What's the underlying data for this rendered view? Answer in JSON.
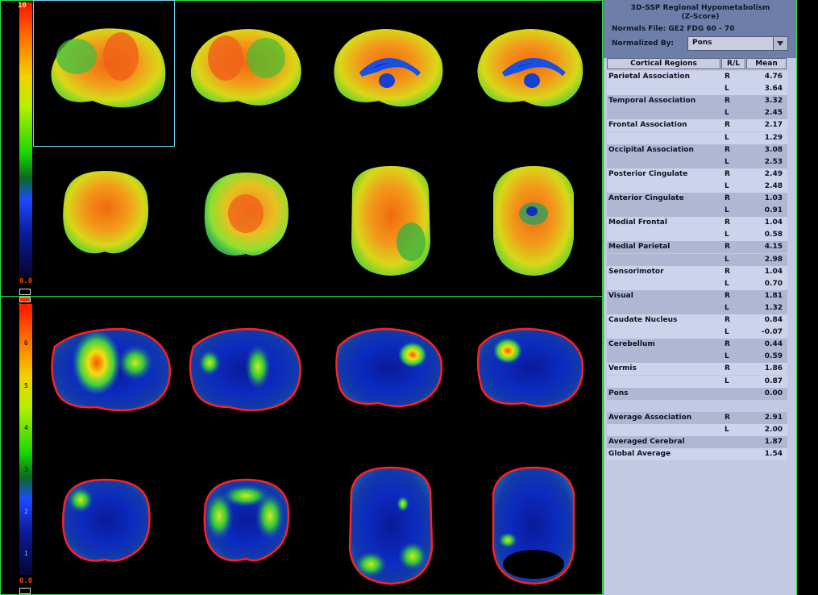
{
  "colorbar_top": {
    "max_label": "10",
    "min_label": "0.0"
  },
  "colorbar_bottom": {
    "max_label": "7.0",
    "min_label": "0.0",
    "ticks": [
      "6",
      "5",
      "4",
      "3",
      "2",
      "1"
    ]
  },
  "panel": {
    "title_line1": "3D-SSP Regional Hypometabolism",
    "title_line2": "(Z-Score)",
    "normals_file": "Normals File: GE2 FDG 60 - 70",
    "normalized_label": "Normalized By:",
    "normalized_value": "Pons",
    "headers": {
      "region": "Cortical Regions",
      "side": "R/L",
      "mean": "Mean"
    },
    "rows": [
      {
        "name": "Parietal Association",
        "side": "R",
        "mean": "4.76"
      },
      {
        "name": "",
        "side": "L",
        "mean": "3.64"
      },
      {
        "name": "Temporal Association",
        "side": "R",
        "mean": "3.32"
      },
      {
        "name": "",
        "side": "L",
        "mean": "2.45"
      },
      {
        "name": "Frontal Association",
        "side": "R",
        "mean": "2.17"
      },
      {
        "name": "",
        "side": "L",
        "mean": "1.29"
      },
      {
        "name": "Occipital Association",
        "side": "R",
        "mean": "3.08"
      },
      {
        "name": "",
        "side": "L",
        "mean": "2.53"
      },
      {
        "name": "Posterior Cingulate",
        "side": "R",
        "mean": "2.49"
      },
      {
        "name": "",
        "side": "L",
        "mean": "2.48"
      },
      {
        "name": "Anterior Cingulate",
        "side": "R",
        "mean": "1.03"
      },
      {
        "name": "",
        "side": "L",
        "mean": "0.91"
      },
      {
        "name": "Medial Frontal",
        "side": "R",
        "mean": "1.04"
      },
      {
        "name": "",
        "side": "L",
        "mean": "0.58"
      },
      {
        "name": "Medial Parietal",
        "side": "R",
        "mean": "4.15"
      },
      {
        "name": "",
        "side": "L",
        "mean": "2.98"
      },
      {
        "name": "Sensorimotor",
        "side": "R",
        "mean": "1.04"
      },
      {
        "name": "",
        "side": "L",
        "mean": "0.70"
      },
      {
        "name": "Visual",
        "side": "R",
        "mean": "1.81"
      },
      {
        "name": "",
        "side": "L",
        "mean": "1.32"
      },
      {
        "name": "Caudate Nucleus",
        "side": "R",
        "mean": "0.84"
      },
      {
        "name": "",
        "side": "L",
        "mean": "-0.07"
      },
      {
        "name": "Cerebellum",
        "side": "R",
        "mean": "0.44"
      },
      {
        "name": "",
        "side": "L",
        "mean": "0.59"
      },
      {
        "name": "Vermis",
        "side": "R",
        "mean": "1.86"
      },
      {
        "name": "",
        "side": "L",
        "mean": "0.87"
      },
      {
        "name": "Pons",
        "side": "",
        "mean": "0.00"
      },
      {
        "name": "",
        "side": "",
        "mean": ""
      },
      {
        "name": "Average Association",
        "side": "R",
        "mean": "2.91"
      },
      {
        "name": "",
        "side": "L",
        "mean": "2.00"
      },
      {
        "name": "Averaged Cerebral",
        "side": "",
        "mean": "1.87"
      },
      {
        "name": "Global Average",
        "side": "",
        "mean": "1.54"
      }
    ]
  },
  "colors": {
    "panel_bg": "#c3c9e2",
    "panel_header": "#6d7fa8",
    "border_green": "#32e040",
    "selection_cyan": "#6fd4ee"
  }
}
